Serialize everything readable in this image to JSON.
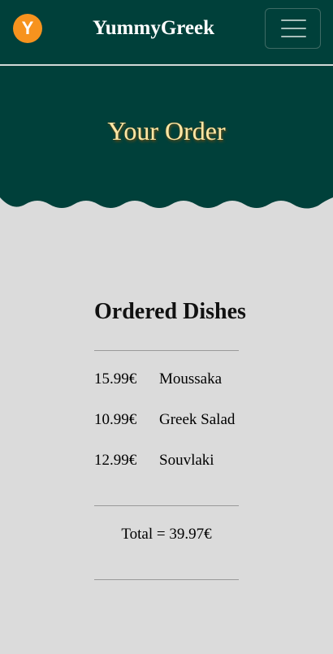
{
  "header": {
    "logo_letter": "Y",
    "brand": "YummyGreek",
    "menu_icon": "hamburger-menu-icon"
  },
  "hero": {
    "title": "Your Order"
  },
  "order": {
    "title": "Ordered Dishes",
    "items": [
      {
        "price": "15.99€",
        "name": "Moussaka"
      },
      {
        "price": "10.99€",
        "name": "Greek Salad"
      },
      {
        "price": "12.99€",
        "name": "Souvlaki"
      }
    ],
    "total": "Total = 39.97€"
  },
  "colors": {
    "header_bg": "#00403a",
    "logo_bg": "#f7931e",
    "hero_title": "#fde7a6",
    "page_bg": "#dbdbdb"
  }
}
